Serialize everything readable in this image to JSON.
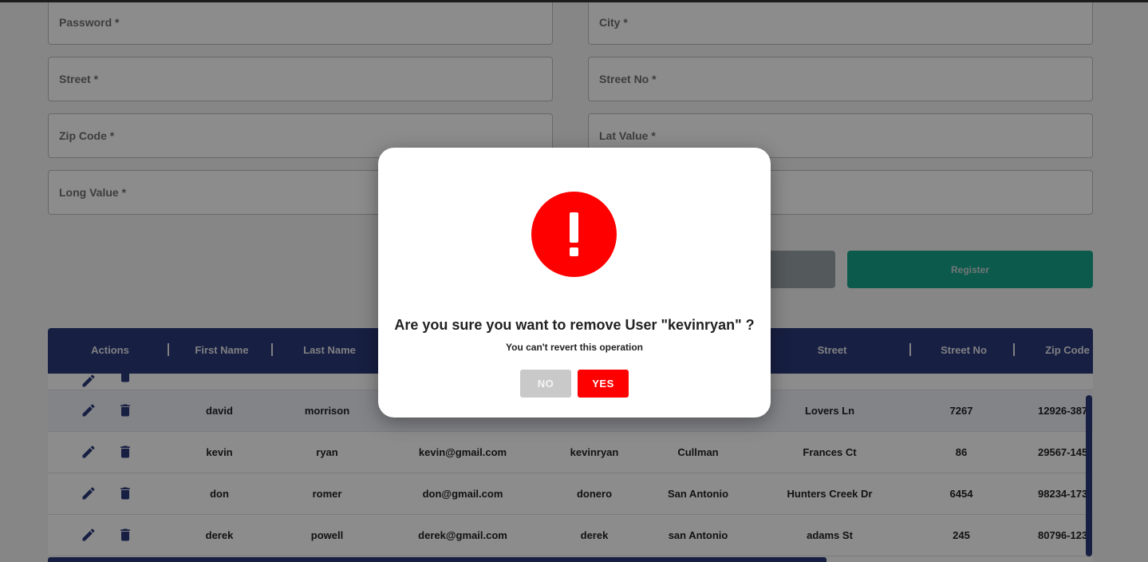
{
  "form": {
    "fields": [
      {
        "label": "Password *"
      },
      {
        "label": "City *"
      },
      {
        "label": "Street *"
      },
      {
        "label": "Street No *"
      },
      {
        "label": "Zip Code *"
      },
      {
        "label": "Lat Value *"
      },
      {
        "label": "Long Value *"
      }
    ],
    "register_label": "Register"
  },
  "table": {
    "columns": [
      "Actions",
      "First Name",
      "Last Name",
      "Street",
      "Street No",
      "Zip Code"
    ],
    "rows": [
      {
        "first": "david",
        "last": "morrison",
        "email": "",
        "username": "",
        "city": "",
        "street": "Lovers Ln",
        "street_no": "7267",
        "zip": "12926-387"
      },
      {
        "first": "kevin",
        "last": "ryan",
        "email": "kevin@gmail.com",
        "username": "kevinryan",
        "city": "Cullman",
        "street": "Frances Ct",
        "street_no": "86",
        "zip": "29567-145"
      },
      {
        "first": "don",
        "last": "romer",
        "email": "don@gmail.com",
        "username": "donero",
        "city": "San Antonio",
        "street": "Hunters Creek Dr",
        "street_no": "6454",
        "zip": "98234-173"
      },
      {
        "first": "derek",
        "last": "powell",
        "email": "derek@gmail.com",
        "username": "derek",
        "city": "san Antonio",
        "street": "adams St",
        "street_no": "245",
        "zip": "80796-123"
      }
    ]
  },
  "modal": {
    "title": "Are you sure you want to remove User \"kevinryan\" ?",
    "subtitle": "You can't revert this operation",
    "no_label": "NO",
    "yes_label": "YES"
  },
  "colors": {
    "header_bg": "#2a3a78",
    "register": "#17a589",
    "danger": "#ff0000",
    "no_button": "#c9c9c9"
  }
}
